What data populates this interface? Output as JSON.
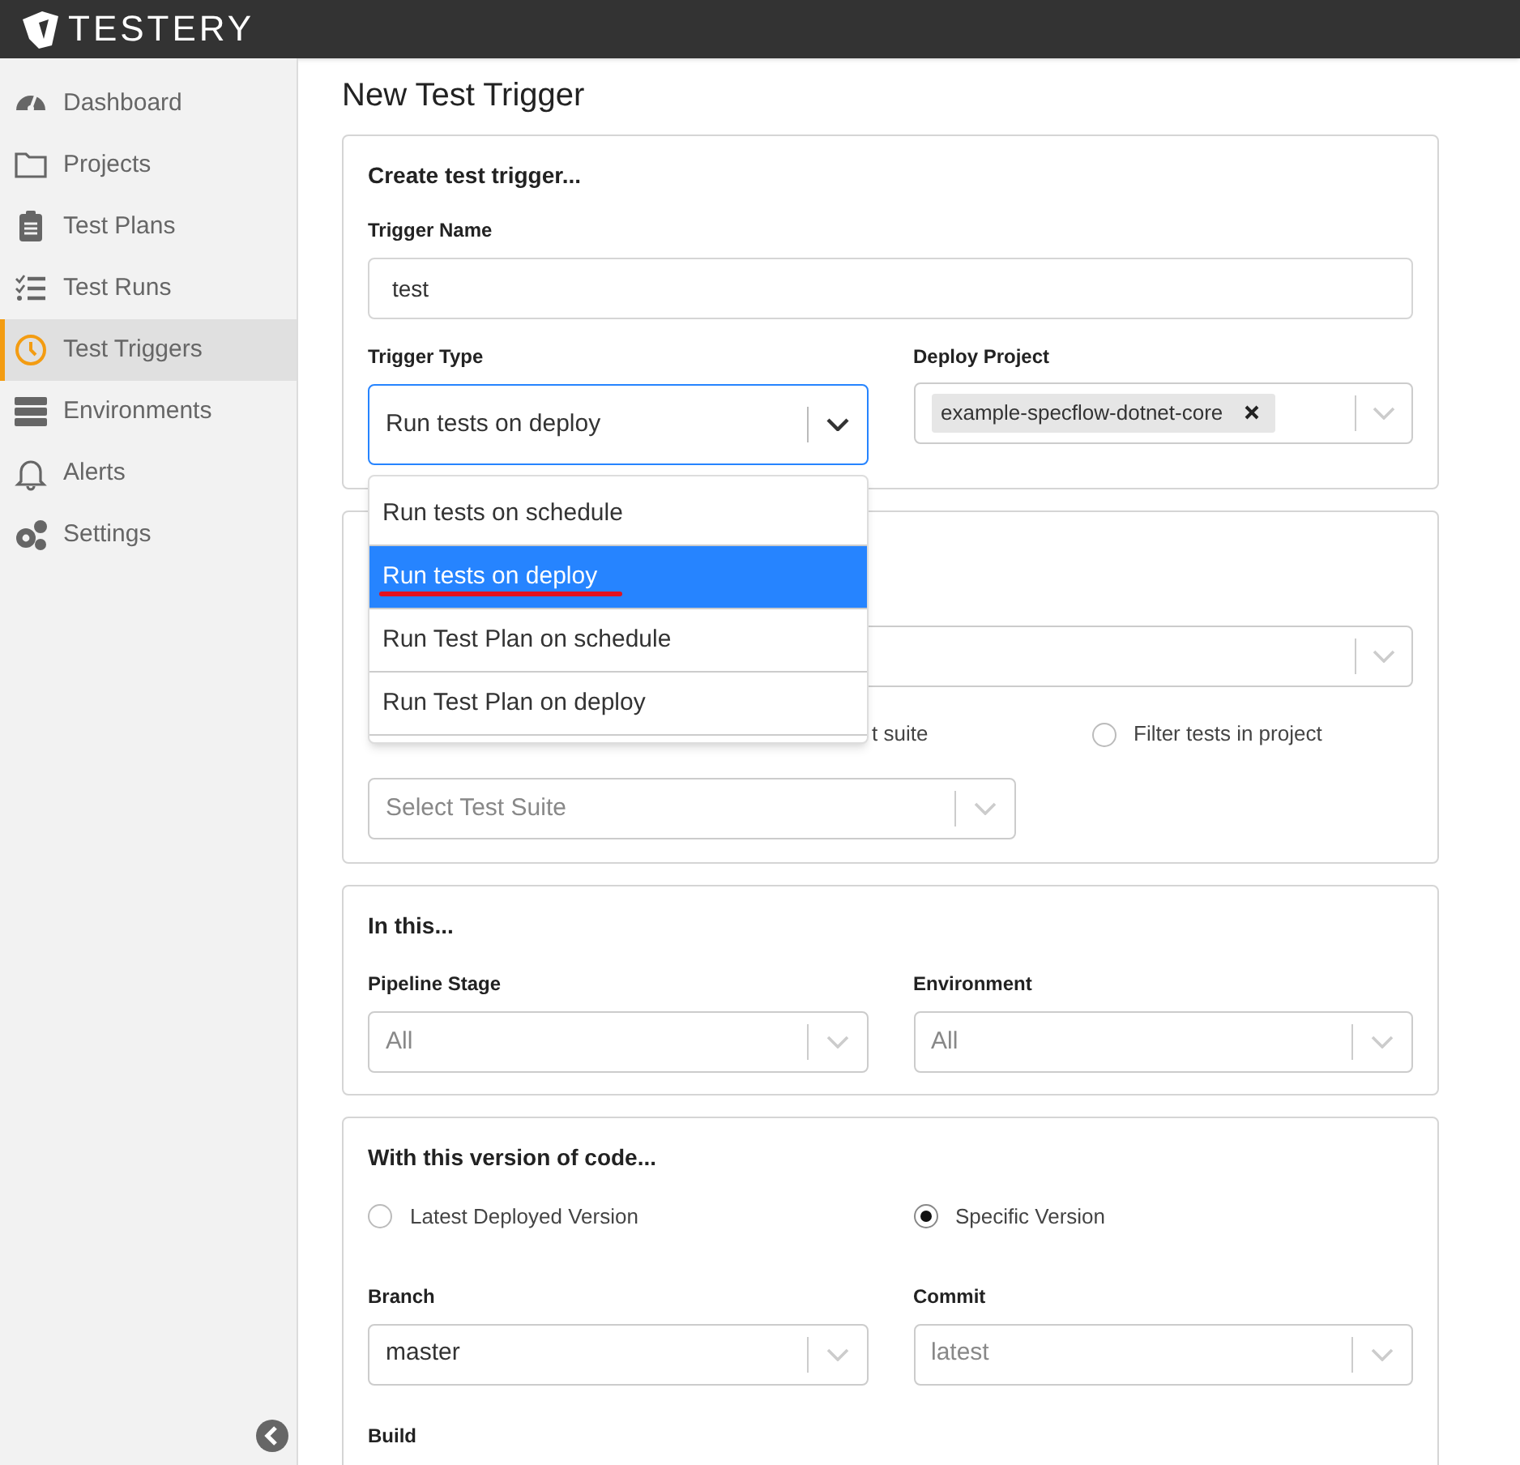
{
  "app": {
    "logo": "TESTERY"
  },
  "sidebar": {
    "items": [
      {
        "label": "Dashboard",
        "selected": false
      },
      {
        "label": "Projects",
        "selected": false
      },
      {
        "label": "Test Plans",
        "selected": false
      },
      {
        "label": "Test Runs",
        "selected": false
      },
      {
        "label": "Test Triggers",
        "selected": true
      },
      {
        "label": "Environments",
        "selected": false
      },
      {
        "label": "Alerts",
        "selected": false
      },
      {
        "label": "Settings",
        "selected": false
      }
    ]
  },
  "page_title": "New Test Trigger",
  "trigger_card": {
    "title": "Create test trigger...",
    "trigger_name": {
      "label": "Trigger Name",
      "value": "test"
    },
    "trigger_type": {
      "label": "Trigger Type",
      "value": "Run tests on deploy",
      "open": true,
      "options": [
        {
          "label": "Run tests on schedule",
          "selected": false,
          "underlined": false
        },
        {
          "label": "Run tests on deploy",
          "selected": true,
          "underlined": true
        },
        {
          "label": "Run Test Plan on schedule",
          "selected": false,
          "underlined": false
        },
        {
          "label": "Run Test Plan on deploy",
          "selected": false,
          "underlined": false
        }
      ]
    },
    "deploy_project": {
      "label": "Deploy Project",
      "tags": [
        "example-specflow-dotnet-core"
      ]
    }
  },
  "tests_card": {
    "partial_label": "t suite",
    "radio": {
      "label": "Filter tests in project",
      "selected": false
    },
    "test_suite": {
      "placeholder": "Select Test Suite"
    }
  },
  "scope_card": {
    "title": "In this...",
    "fields": [
      {
        "label": "Pipeline Stage",
        "placeholder": "All"
      },
      {
        "label": "Environment",
        "placeholder": "All"
      }
    ]
  },
  "version_card": {
    "title": "With this version of code...",
    "radios": [
      {
        "label": "Latest Deployed Version",
        "selected": false
      },
      {
        "label": "Specific Version",
        "selected": true
      }
    ],
    "fields": [
      {
        "label": "Branch",
        "value": "master"
      },
      {
        "label": "Commit",
        "placeholder": "latest"
      }
    ],
    "build_label": "Build"
  }
}
